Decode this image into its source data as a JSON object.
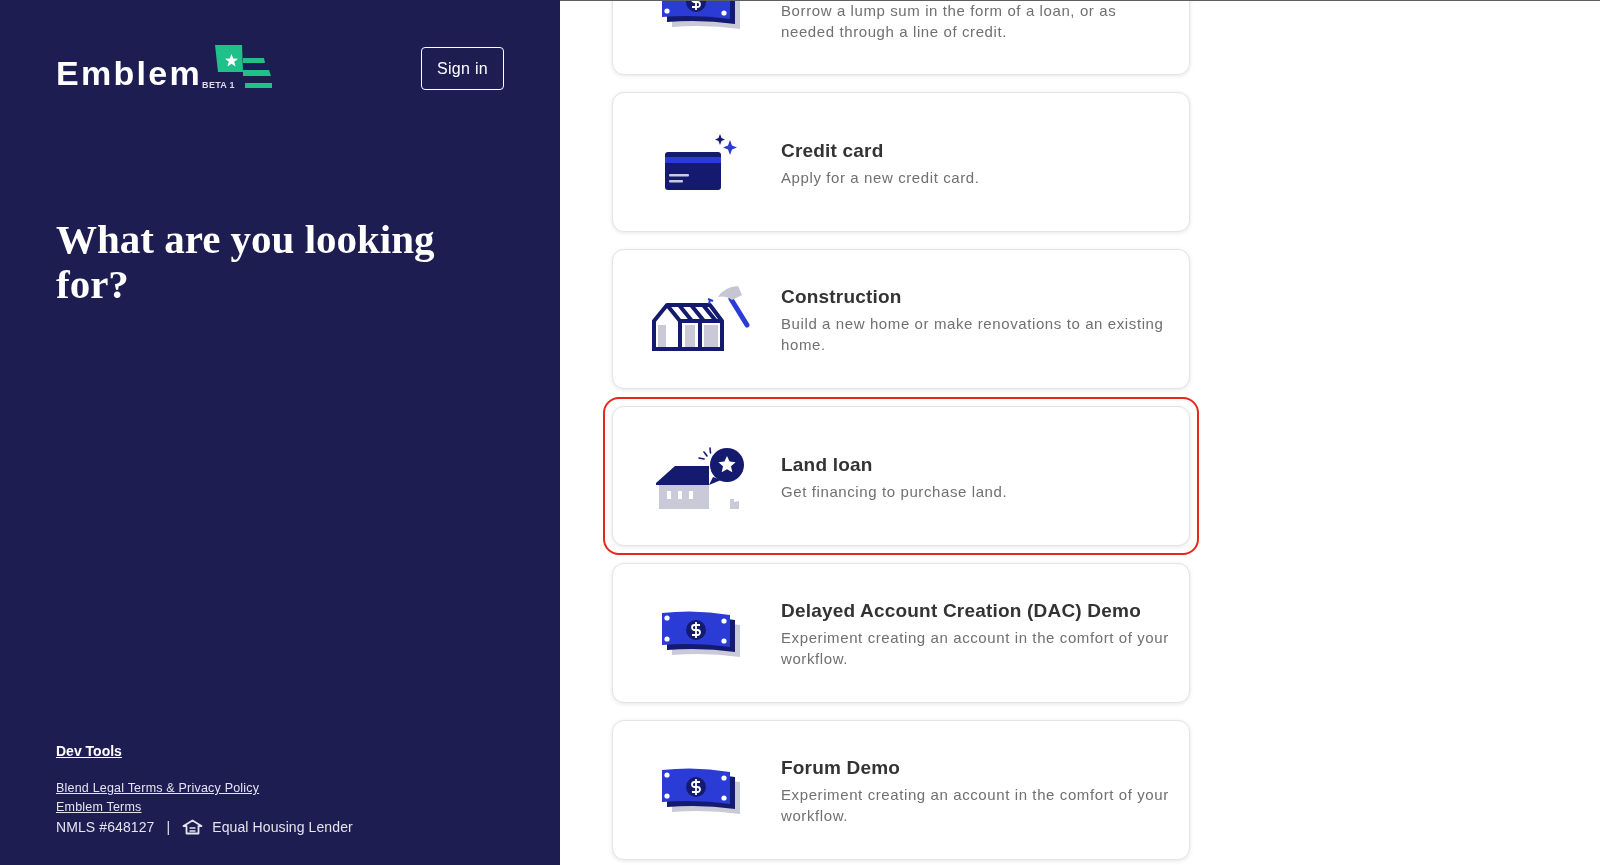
{
  "sidebar": {
    "logo": {
      "wordmark": "Emblem",
      "badge": "BETA 1"
    },
    "sign_in_button": "Sign in",
    "heading": "What are you looking for?",
    "footer": {
      "dev_tools_link": "Dev Tools",
      "links": [
        "Blend Legal Terms & Privacy Policy",
        "Emblem Terms"
      ],
      "nmls": "NMLS #648127",
      "separator": "|",
      "equal_housing": "Equal Housing Lender"
    }
  },
  "cards": [
    {
      "kind": "money",
      "description": "Borrow a lump sum in the form of a loan, or as needed through a line of credit.",
      "highlighted": false
    },
    {
      "kind": "credit_card",
      "title": "Credit card",
      "description": "Apply for a new credit card.",
      "highlighted": false
    },
    {
      "kind": "construction",
      "title": "Construction",
      "description": "Build a new home or make renovations to an existing home.",
      "highlighted": false
    },
    {
      "kind": "land",
      "title": "Land loan",
      "description": "Get financing to purchase land.",
      "highlighted": true
    },
    {
      "kind": "money",
      "title": "Delayed Account Creation (DAC) Demo",
      "description": "Experiment creating an account in the comfort of your workflow.",
      "highlighted": false
    },
    {
      "kind": "money",
      "title": "Forum Demo",
      "description": "Experiment creating an account in the comfort of your workflow.",
      "highlighted": false
    }
  ]
}
